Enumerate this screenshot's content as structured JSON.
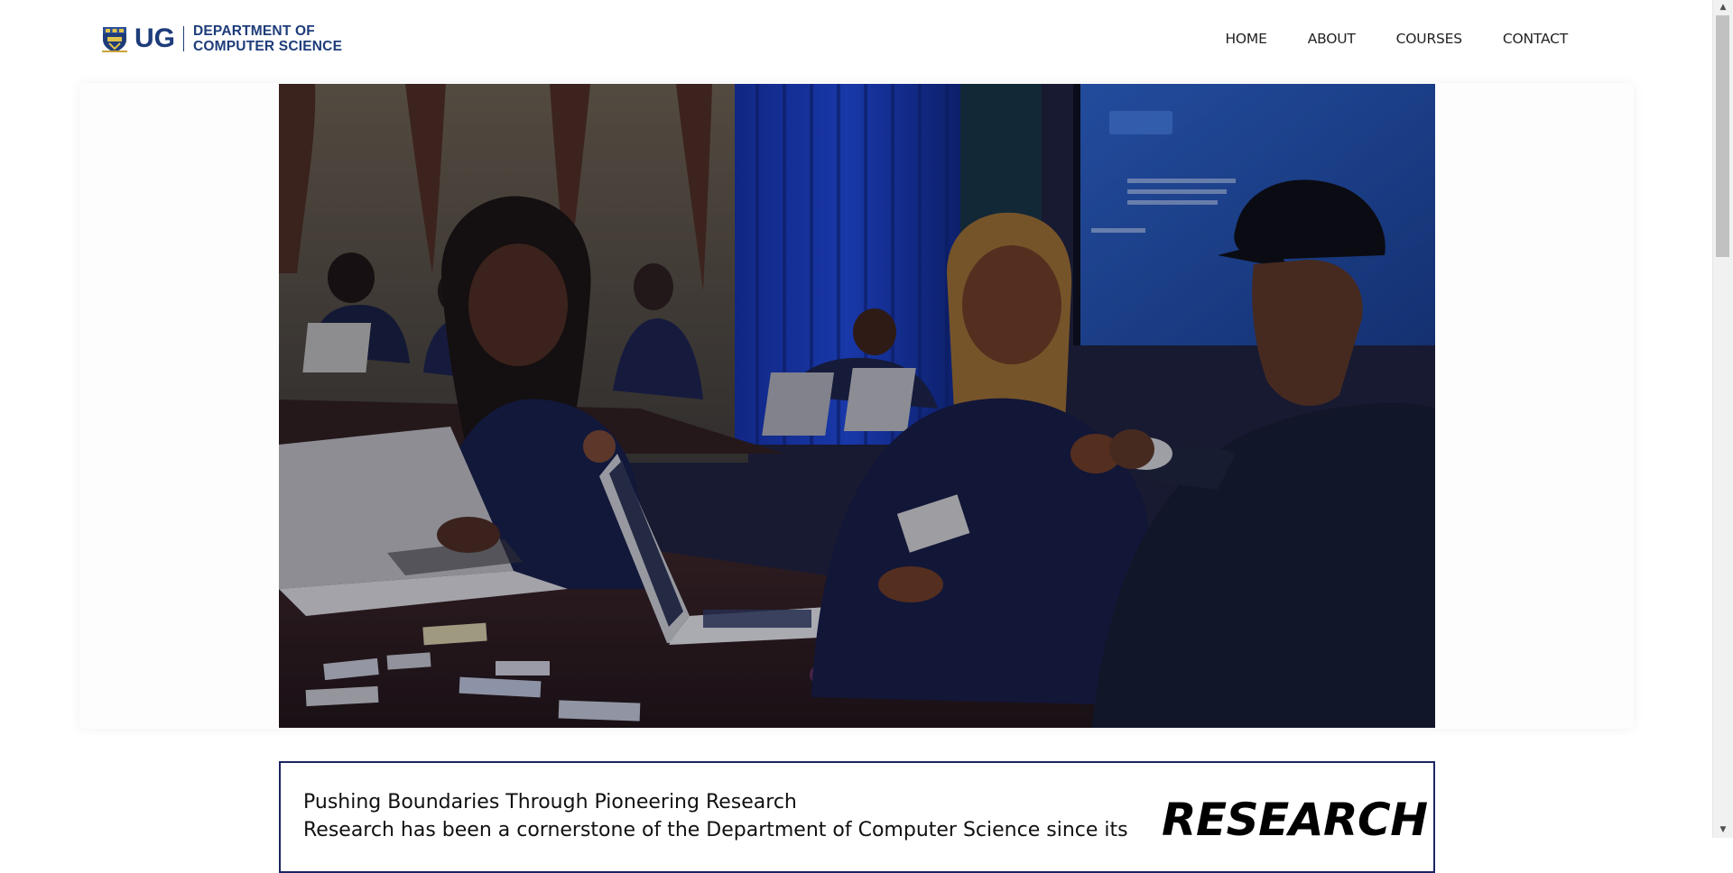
{
  "header": {
    "logo_short": "UG",
    "logo_line1": "DEPARTMENT OF",
    "logo_line2": "COMPUTER SCIENCE",
    "crest_icon": "university-crest-icon"
  },
  "nav": {
    "items": [
      "HOME",
      "ABOUT",
      "COURSES",
      "CONTACT"
    ]
  },
  "hero": {
    "image": "photo: students at laptops in a classroom with a man in a black cap fist-bumping a student"
  },
  "research": {
    "title": "Pushing Boundaries Through Pioneering Research",
    "body": "Research has been a cornerstone of the Department of Computer Science since its",
    "heading": "RESEARCH"
  },
  "scrollbar": {
    "up_icon": "scroll-up-arrow-icon",
    "down_icon": "scroll-down-arrow-icon"
  },
  "colors": {
    "brand": "#1e3c7a",
    "card_border": "#1b2560",
    "scroll_thumb": "#c1c1c1"
  }
}
